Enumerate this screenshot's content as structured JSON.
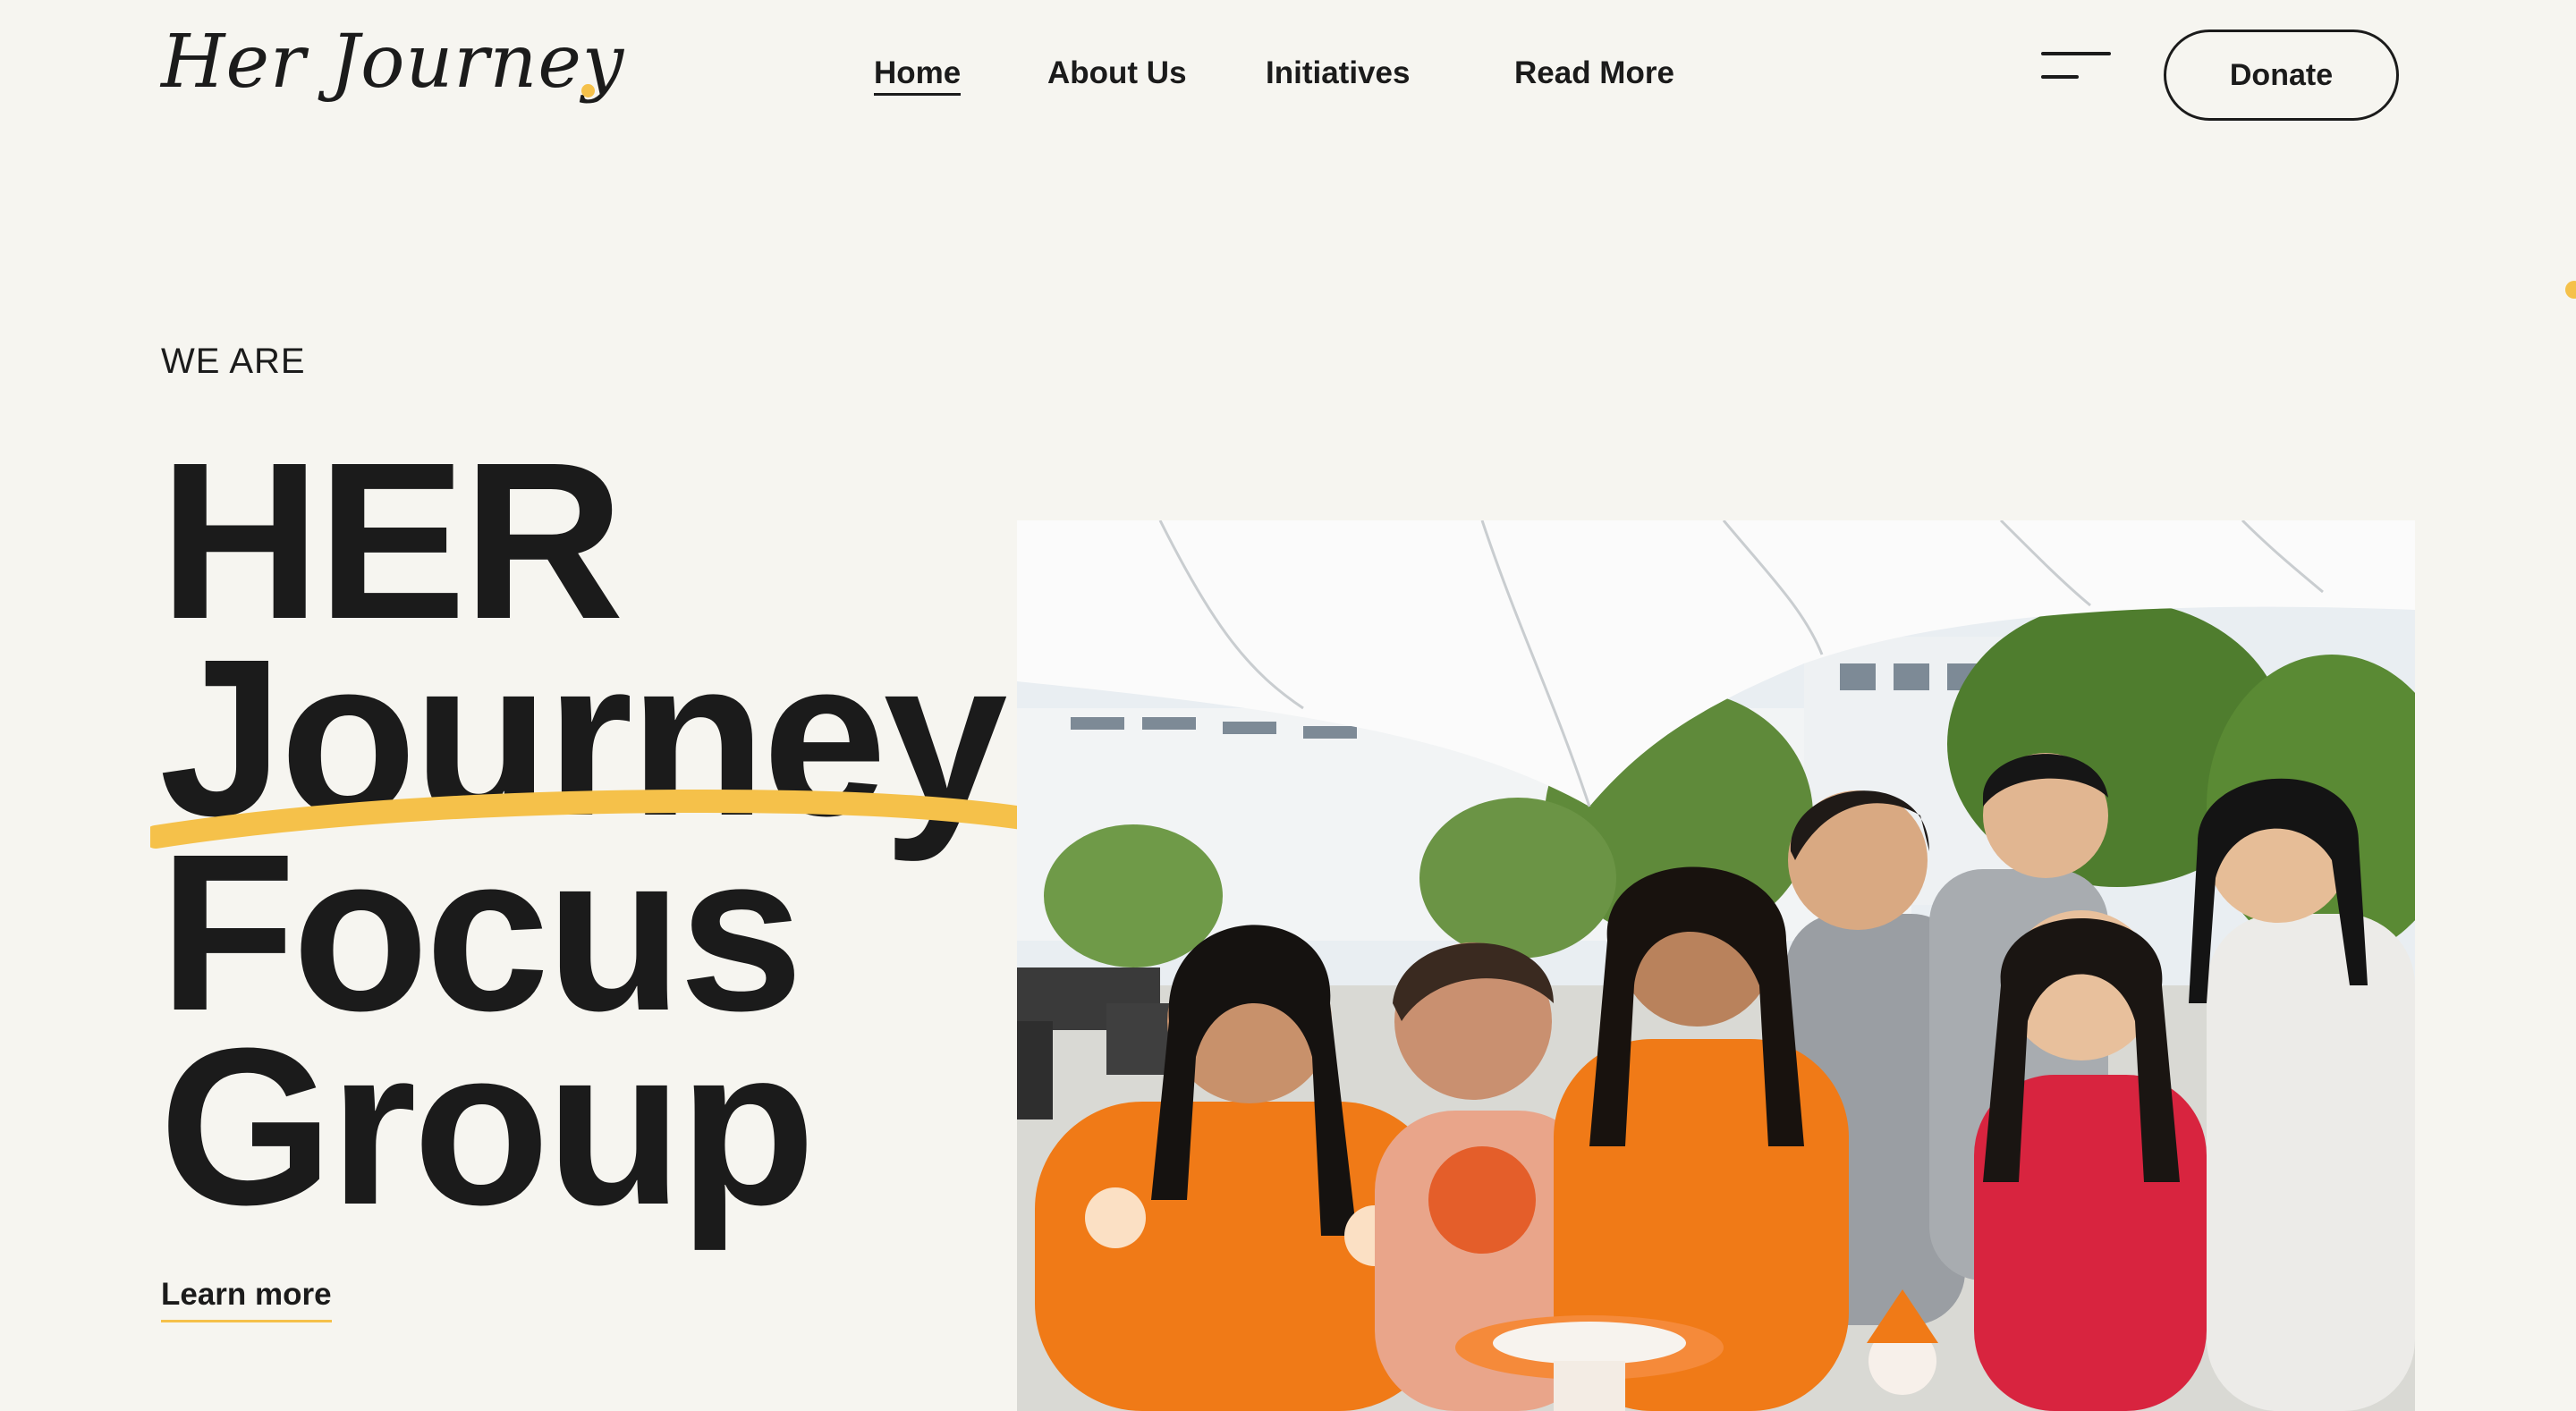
{
  "header": {
    "logo_text": "Her Journey",
    "nav": [
      {
        "label": "Home",
        "active": true
      },
      {
        "label": "About Us",
        "active": false
      },
      {
        "label": "Initiatives",
        "active": false
      },
      {
        "label": "Read More",
        "active": false
      }
    ],
    "menu_icon": "hamburger-menu-icon",
    "donate_label": "Donate"
  },
  "hero": {
    "eyebrow": "WE ARE",
    "title_lines": [
      "HER",
      "Journey",
      "Focus",
      "Group"
    ],
    "cta_label": "Learn more",
    "photo_subject": "group photo"
  },
  "colors": {
    "background": "#f6f5f0",
    "text": "#1b1b1b",
    "accent_yellow": "#f5c14a",
    "shirt_orange": "#f07a17"
  }
}
